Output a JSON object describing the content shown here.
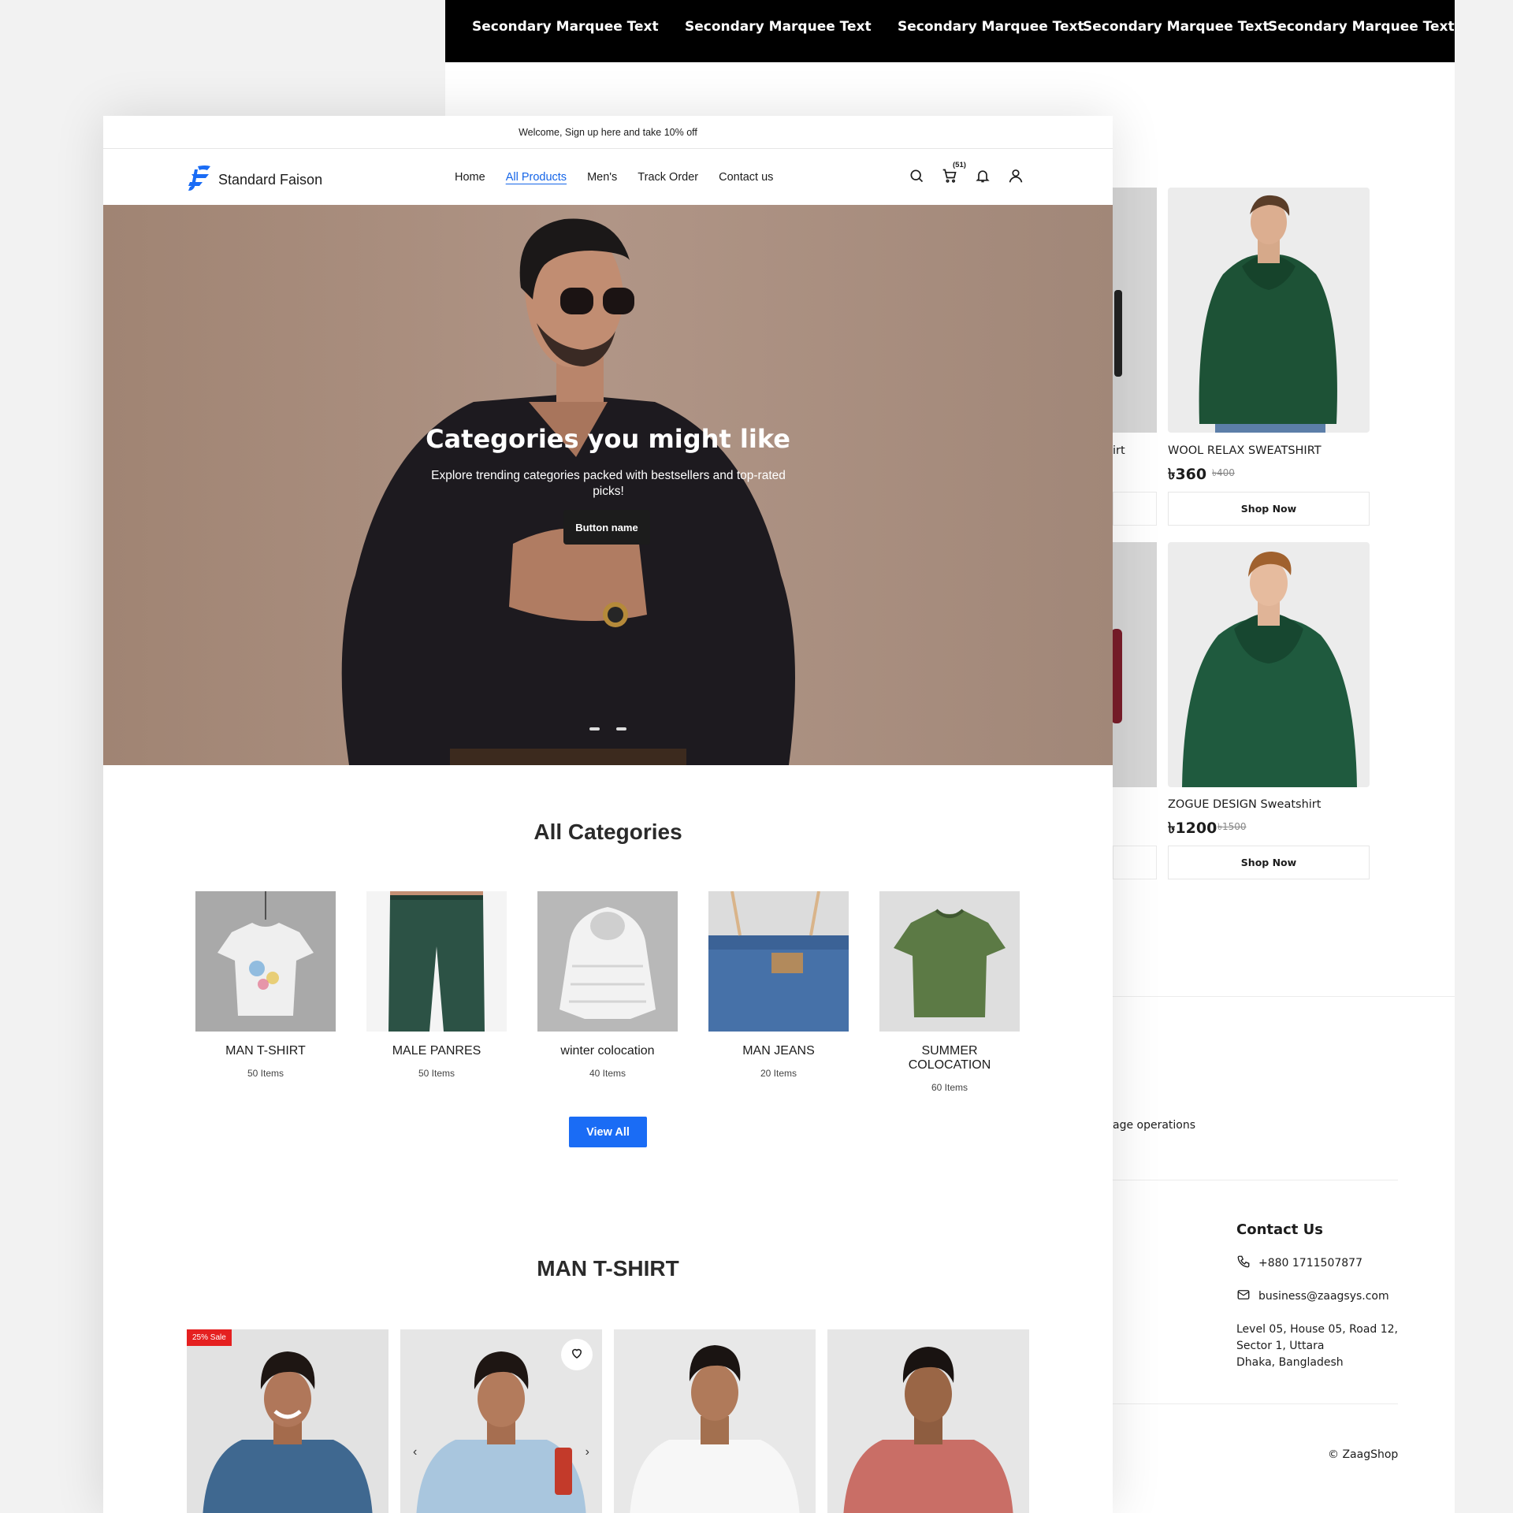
{
  "marquee": {
    "items": [
      "Secondary Marquee Text",
      "Secondary Marquee Text",
      "Secondary Marquee Text",
      "Secondary Marquee Text",
      "Secondary Marquee Text"
    ]
  },
  "back_products": [
    {
      "name": "WOOL RELAX SWEATSHIRT",
      "price": "৳360",
      "old_price": "৳400",
      "button": "Shop Now",
      "partial_name": "irt"
    },
    {
      "name": "ZOGUE DESIGN Sweatshirt",
      "price": "৳1200",
      "old_price": "৳1500",
      "button": "Shop Now"
    }
  ],
  "back_partial_text": "age operations",
  "footer": {
    "contact_title": "Contact Us",
    "phone": "+880 1711507877",
    "email": "business@zaagsys.com",
    "address_lines": [
      "Level 05, House 05, Road 12,",
      "Sector 1, Uttara",
      "Dhaka, Bangladesh"
    ],
    "copyright": "© ZaagShop"
  },
  "topbar": {
    "text": "Welcome, Sign up here and take 10% off"
  },
  "brand": {
    "name": "Standard Faison",
    "accent": "#1a6cf5"
  },
  "nav": {
    "links": [
      {
        "label": "Home"
      },
      {
        "label": "All Products",
        "active": true
      },
      {
        "label": "Men's"
      },
      {
        "label": "Track Order"
      },
      {
        "label": "Contact us"
      }
    ],
    "cart_count": "(51)",
    "icons": [
      "search-icon",
      "cart-icon",
      "bell-icon",
      "user-icon"
    ]
  },
  "hero": {
    "title": "Categories you might like",
    "subtitle": "Explore trending categories packed with bestsellers and top-rated picks!",
    "button": "Button name"
  },
  "categories": {
    "title": "All Categories",
    "items": [
      {
        "name": "MAN T-SHIRT",
        "count": "50 Items"
      },
      {
        "name": "MALE PANRES",
        "count": "50 Items"
      },
      {
        "name": "winter colocation",
        "count": "40 Items"
      },
      {
        "name": "MAN JEANS",
        "count": "20 Items"
      },
      {
        "name": "SUMMER COLOCATION",
        "count": "60 Items"
      }
    ],
    "view_all": "View All"
  },
  "tshirt_section": {
    "title": "MAN T-SHIRT",
    "sale_badge": "25% Sale"
  }
}
